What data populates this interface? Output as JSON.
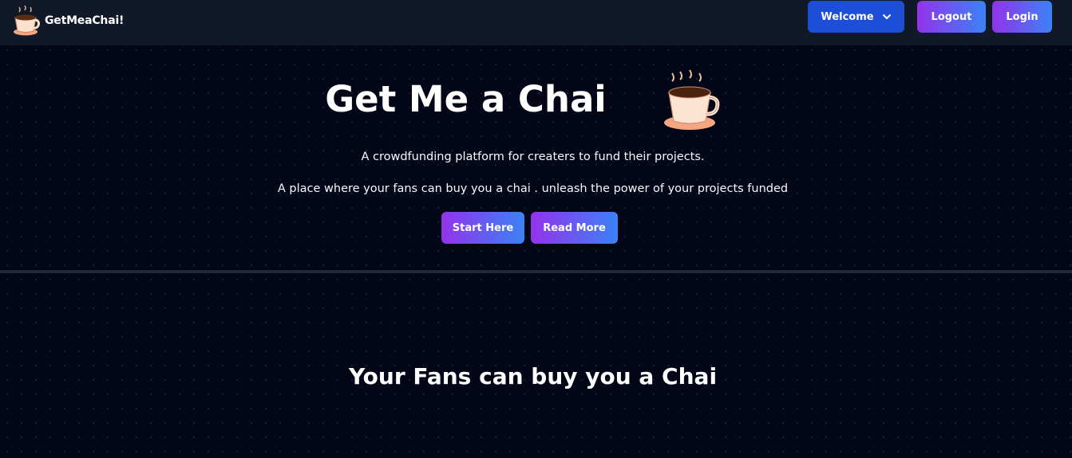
{
  "nav": {
    "brand": "GetMeaChai!",
    "brand_icon": "chai-cup-icon",
    "welcome_label": "Welcome",
    "logout_label": "Logout",
    "login_label": "Login"
  },
  "hero": {
    "title": "Get Me a Chai",
    "icon": "chai-cup-icon",
    "tagline": "A crowdfunding platform for creaters to fund their projects.",
    "subtagline": "A place where your fans can buy you a chai . unleash the power of your projects funded",
    "start_label": "Start Here",
    "read_label": "Read More"
  },
  "section": {
    "title": "Your Fans can buy you a Chai"
  },
  "colors": {
    "background": "#020617",
    "navbar": "#111827",
    "welcome_button": "#1d4ed8",
    "gradient_start": "#9333ea",
    "gradient_end": "#3b82f6"
  }
}
